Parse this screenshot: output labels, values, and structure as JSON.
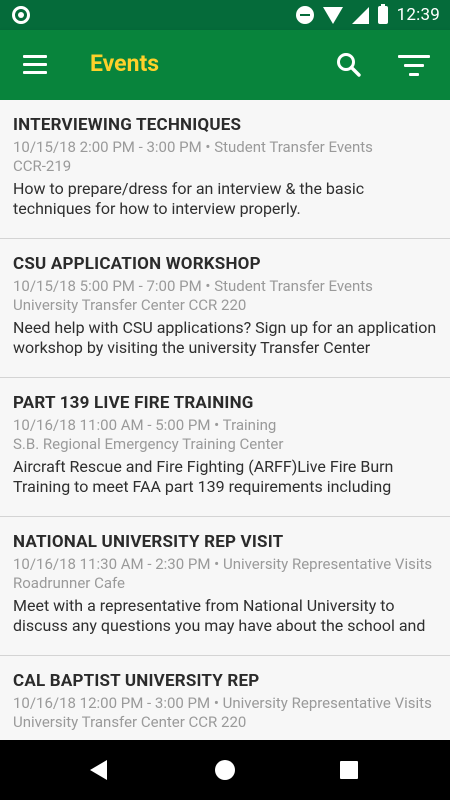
{
  "status_bar": {
    "time": "12:39"
  },
  "app_bar": {
    "title": "Events",
    "icons": [
      "menu-icon",
      "search-icon",
      "filter-icon"
    ],
    "colors": {
      "status_bar": "#056b3a",
      "app_bar": "#08843c",
      "title": "#fed12a"
    }
  },
  "events": [
    {
      "title": "INTERVIEWING TECHNIQUES",
      "datetime": "10/15/18 2:00 PM - 3:00 PM",
      "category": "Student Transfer Events",
      "location": "CCR-219",
      "description": "How to prepare/dress for an interview & the basic techniques for how to interview properly."
    },
    {
      "title": "CSU APPLICATION WORKSHOP",
      "datetime": "10/15/18 5:00 PM - 7:00 PM",
      "category": "Student Transfer Events",
      "location": "University Transfer Center CCR 220",
      "description": "Need help with CSU applications? Sign up for an application workshop by visiting the university Transfer Center"
    },
    {
      "title": "PART 139 LIVE FIRE TRAINING",
      "datetime": "10/16/18 11:00 AM - 5:00 PM",
      "category": "Training",
      "location": "S.B. Regional Emergency Training Center",
      "description": "Aircraft Rescue and Fire Fighting (ARFF)Live Fire Burn Training to meet FAA part 139 requirements including"
    },
    {
      "title": "NATIONAL UNIVERSITY REP VISIT",
      "datetime": "10/16/18 11:30 AM - 2:30 PM",
      "category": "University Representative Visits",
      "location": "Roadrunner Cafe",
      "description": "Meet with a representative from National University to discuss any questions you may have about the school and"
    },
    {
      "title": "CAL BAPTIST UNIVERSITY REP",
      "datetime": "10/16/18 12:00 PM - 3:00 PM",
      "category": "University Representative Visits",
      "location": "University Transfer Center CCR 220",
      "description": ""
    }
  ],
  "meta_separator": "•",
  "nav_bar": {
    "icons": [
      "back-icon",
      "home-icon",
      "recents-icon"
    ]
  }
}
